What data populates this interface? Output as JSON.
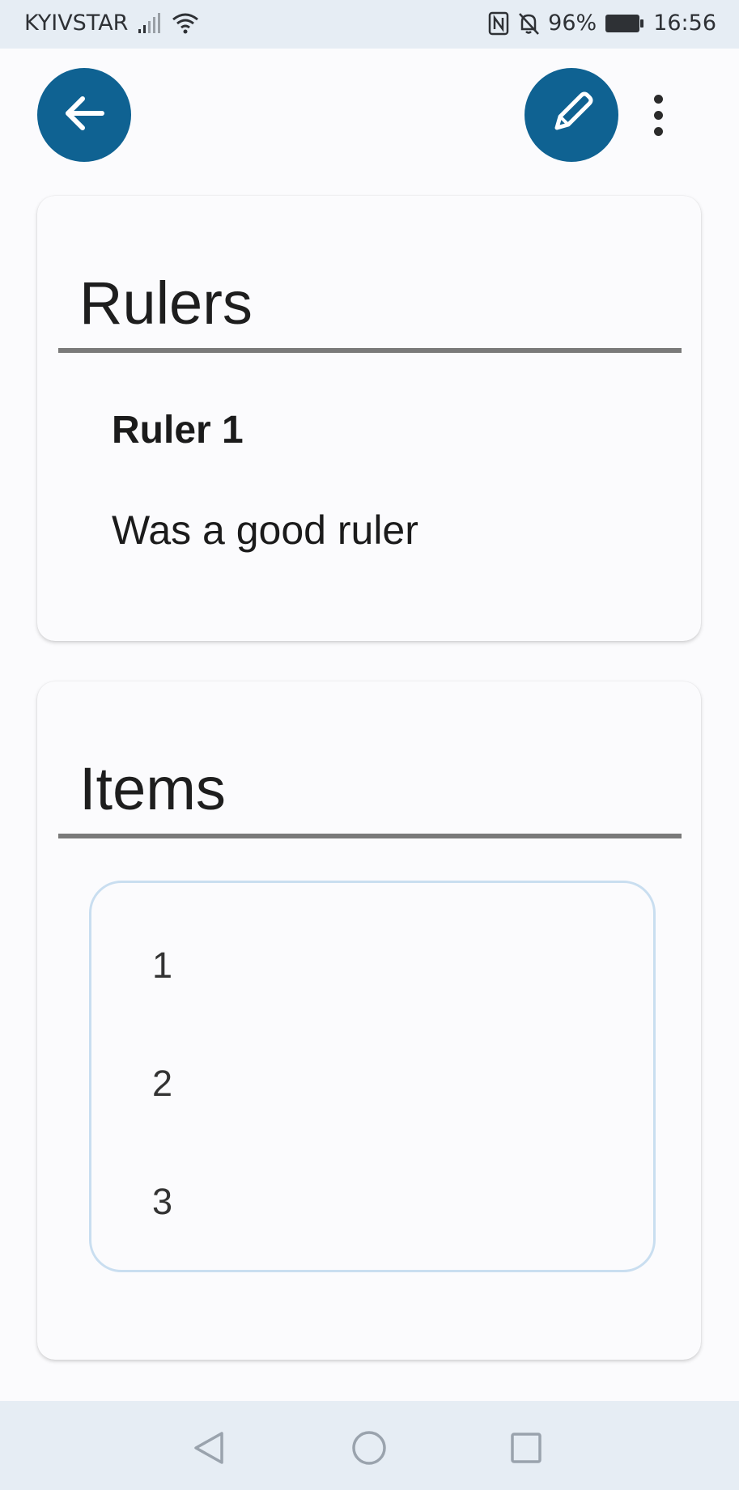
{
  "status_bar": {
    "carrier": "KYIVSTAR",
    "battery_percent": "96%",
    "time": "16:56"
  },
  "header": {
    "back_icon": "arrow-left-icon",
    "edit_icon": "pencil-icon",
    "menu_icon": "more-vertical-icon",
    "accent_color": "#0f6292"
  },
  "rulers_section": {
    "title": "Rulers",
    "ruler_name": "Ruler 1",
    "ruler_description": "Was a good ruler"
  },
  "items_section": {
    "title": "Items",
    "items": [
      "1",
      "2",
      "3"
    ]
  },
  "nav_bar": {
    "back_icon": "triangle-back-icon",
    "home_icon": "circle-home-icon",
    "recents_icon": "square-recents-icon"
  }
}
